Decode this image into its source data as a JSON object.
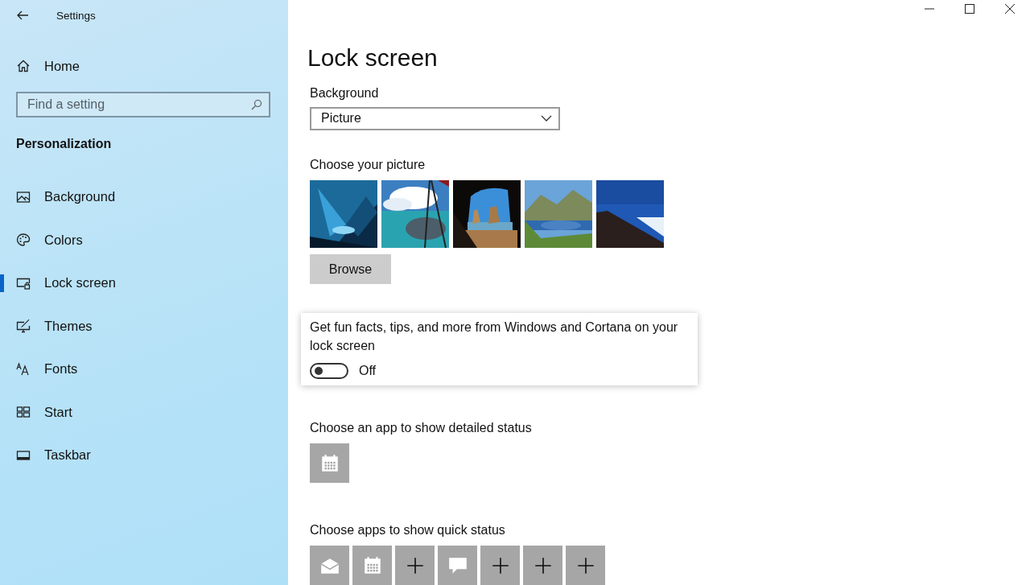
{
  "window": {
    "title": "Settings"
  },
  "sidebar": {
    "home": "Home",
    "search": {
      "placeholder": "Find a setting"
    },
    "section": "Personalization",
    "items": [
      {
        "label": "Background",
        "kind": "background",
        "selected": false
      },
      {
        "label": "Colors",
        "kind": "colors",
        "selected": false
      },
      {
        "label": "Lock screen",
        "kind": "lock",
        "selected": true
      },
      {
        "label": "Themes",
        "kind": "themes",
        "selected": false
      },
      {
        "label": "Fonts",
        "kind": "fonts",
        "selected": false
      },
      {
        "label": "Start",
        "kind": "start",
        "selected": false
      },
      {
        "label": "Taskbar",
        "kind": "taskbar",
        "selected": false
      }
    ]
  },
  "page": {
    "title": "Lock screen",
    "background_label": "Background",
    "background_dropdown": {
      "value": "Picture"
    },
    "choose_picture_label": "Choose your picture",
    "browse_button": "Browse",
    "fun_facts": {
      "label": "Get fun facts, tips, and more from Windows and Cortana on your lock screen",
      "toggle": {
        "on": false,
        "state_text": "Off"
      }
    },
    "detailed_status_label": "Choose an app to show detailed status",
    "detailed_status_apps": [
      {
        "kind": "calendar"
      }
    ],
    "quick_status_label": "Choose apps to show quick status",
    "quick_status_apps": [
      {
        "kind": "mail"
      },
      {
        "kind": "calendar"
      },
      {
        "kind": "add"
      },
      {
        "kind": "chat"
      },
      {
        "kind": "add"
      },
      {
        "kind": "add"
      },
      {
        "kind": "add"
      }
    ]
  }
}
